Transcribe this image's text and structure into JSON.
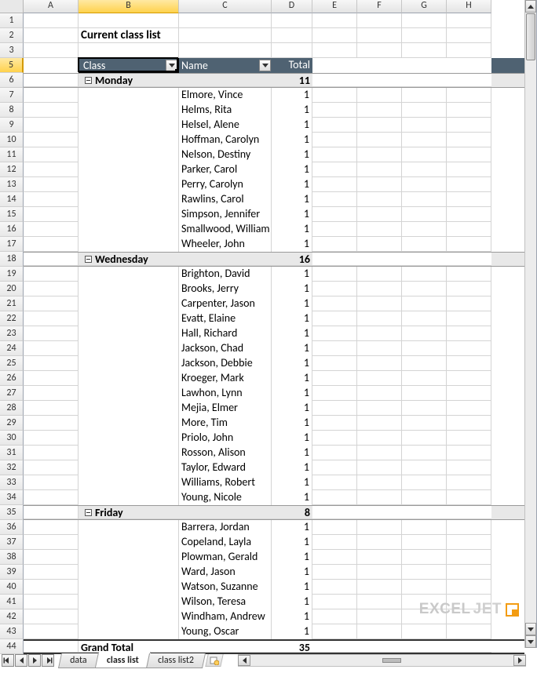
{
  "columns": [
    "A",
    "B",
    "C",
    "D",
    "E",
    "F",
    "G",
    "H"
  ],
  "selected_col": "B",
  "row_start": 1,
  "row_end": 44,
  "selected_row": 5,
  "title_cell": "Current class list",
  "pivot": {
    "headers": {
      "class": "Class",
      "name": "Name",
      "total": "Total"
    },
    "groups": [
      {
        "label": "Monday",
        "total": 11,
        "rows": [
          {
            "name": "Elmore, Vince",
            "v": 1
          },
          {
            "name": "Helms, Rita",
            "v": 1
          },
          {
            "name": "Helsel, Alene",
            "v": 1
          },
          {
            "name": "Hoffman, Carolyn",
            "v": 1
          },
          {
            "name": "Nelson, Destiny",
            "v": 1
          },
          {
            "name": "Parker, Carol",
            "v": 1
          },
          {
            "name": "Perry, Carolyn",
            "v": 1
          },
          {
            "name": "Rawlins, Carol",
            "v": 1
          },
          {
            "name": "Simpson, Jennifer",
            "v": 1
          },
          {
            "name": "Smallwood, William",
            "v": 1
          },
          {
            "name": "Wheeler, John",
            "v": 1
          }
        ]
      },
      {
        "label": "Wednesday",
        "total": 16,
        "rows": [
          {
            "name": "Brighton, David",
            "v": 1
          },
          {
            "name": "Brooks, Jerry",
            "v": 1
          },
          {
            "name": "Carpenter, Jason",
            "v": 1
          },
          {
            "name": "Evatt, Elaine",
            "v": 1
          },
          {
            "name": "Hall, Richard",
            "v": 1
          },
          {
            "name": "Jackson, Chad",
            "v": 1
          },
          {
            "name": "Jackson, Debbie",
            "v": 1
          },
          {
            "name": "Kroeger, Mark",
            "v": 1
          },
          {
            "name": "Lawhon, Lynn",
            "v": 1
          },
          {
            "name": "Mejia, Elmer",
            "v": 1
          },
          {
            "name": "More, Tim",
            "v": 1
          },
          {
            "name": "Priolo, John",
            "v": 1
          },
          {
            "name": "Rosson, Alison",
            "v": 1
          },
          {
            "name": "Taylor, Edward",
            "v": 1
          },
          {
            "name": "Williams, Robert",
            "v": 1
          },
          {
            "name": "Young, Nicole",
            "v": 1
          }
        ]
      },
      {
        "label": "Friday",
        "total": 8,
        "rows": [
          {
            "name": "Barrera, Jordan",
            "v": 1
          },
          {
            "name": "Copeland, Layla",
            "v": 1
          },
          {
            "name": "Plowman, Gerald",
            "v": 1
          },
          {
            "name": "Ward, Jason",
            "v": 1
          },
          {
            "name": "Watson, Suzanne",
            "v": 1
          },
          {
            "name": "Wilson, Teresa",
            "v": 1
          },
          {
            "name": "Windham, Andrew",
            "v": 1
          },
          {
            "name": "Young, Oscar",
            "v": 1
          }
        ]
      }
    ],
    "grand": {
      "label": "Grand Total",
      "total": 35
    }
  },
  "tabs": [
    "data",
    "class list",
    "class list2"
  ],
  "active_tab": "class list",
  "watermark": "EXCEL",
  "watermark_suffix": "JET"
}
